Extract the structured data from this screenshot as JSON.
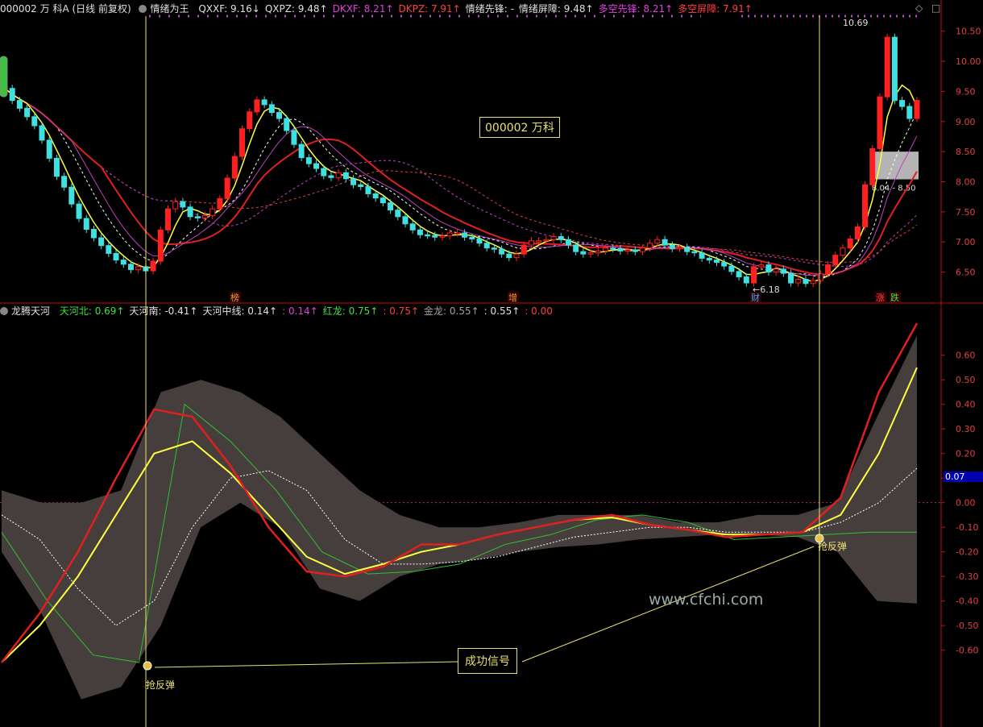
{
  "header": {
    "stock": "000002 万 科A (日线 前复权)",
    "indicator_name": "情绪为王",
    "items": [
      {
        "text": "QXXF: 9.16↓",
        "color": "#e0e0e0"
      },
      {
        "text": "QXPZ: 9.48↑",
        "color": "#e0e0e0"
      },
      {
        "text": "DKXF: 8.21↑",
        "color": "#e040e0"
      },
      {
        "text": "DKPZ: 7.91↑",
        "color": "#ff4040"
      },
      {
        "text": "情绪先锋: -",
        "color": "#e0e0e0"
      },
      {
        "text": "情绪屏障: 9.48↑",
        "color": "#e0e0e0"
      },
      {
        "text": "多空先锋: 8.21↑",
        "color": "#e040e0"
      },
      {
        "text": "多空屏障: 7.91↑",
        "color": "#ff4040"
      }
    ]
  },
  "sub_header": {
    "indicator_name": "龙腾天河",
    "items": [
      {
        "text": "天河北: 0.69↑",
        "color": "#40e040"
      },
      {
        "text": "天河南: -0.41↑",
        "color": "#e0e0e0"
      },
      {
        "text": "天河中线: 0.14↑",
        "color": "#e0e0e0"
      },
      {
        "text": ": 0.14↑",
        "color": "#e040e0"
      },
      {
        "text": "红龙: 0.75↑",
        "color": "#40e040"
      },
      {
        "text": ": 0.75↑",
        "color": "#ff4040"
      },
      {
        "text": "金龙: 0.55↑",
        "color": "#a0a0a0"
      },
      {
        "text": ": 0.55↑",
        "color": "#e0e0e0"
      },
      {
        "text": ": 0.00",
        "color": "#ff4040"
      }
    ]
  },
  "price_box": "000002 万科",
  "signal_box": "成功信号",
  "watermark": "www.cfchi.com",
  "colors": {
    "axis": "#c01010",
    "up": "#ff2020",
    "down": "#40e0e0",
    "ma5": "#ffffff",
    "ma10": "#ffff40",
    "ma20": "#c040c0",
    "ma30": "#e02020"
  },
  "chart_data": [
    {
      "type": "candlestick",
      "title": "000002 万 科A (日线 前复权)",
      "ylim": [
        6.2,
        10.75
      ],
      "yticks": [
        "10.50",
        "10.00",
        "9.50",
        "9.00",
        "8.50",
        "8.00",
        "7.50",
        "7.00",
        "6.50"
      ],
      "high_label": "10.69",
      "low_label": "6.18",
      "zone_label": "8.04 - 8.50",
      "zone": [
        8.04,
        8.5
      ],
      "event_markers": [
        "榜",
        "增",
        "财",
        "涨",
        "跌"
      ],
      "close": [
        9.55,
        9.35,
        9.22,
        9.08,
        8.93,
        8.69,
        8.39,
        8.09,
        7.91,
        7.63,
        7.39,
        7.21,
        7.07,
        6.94,
        6.81,
        6.7,
        6.63,
        6.54,
        6.59,
        6.52,
        6.68,
        7.2,
        7.55,
        7.67,
        7.58,
        7.42,
        7.4,
        7.44,
        7.55,
        7.72,
        8.06,
        8.42,
        8.88,
        9.16,
        9.36,
        9.28,
        9.15,
        9.05,
        8.85,
        8.62,
        8.4,
        8.3,
        8.22,
        8.1,
        8.07,
        8.15,
        8.05,
        7.95,
        7.92,
        7.8,
        7.73,
        7.65,
        7.53,
        7.42,
        7.3,
        7.2,
        7.12,
        7.11,
        7.08,
        7.1,
        7.15,
        7.15,
        7.08,
        7.05,
        6.98,
        6.9,
        6.88,
        6.8,
        6.74,
        6.8,
        6.95,
        7.02,
        7.02,
        7.04,
        7.09,
        7.04,
        6.95,
        6.84,
        6.8,
        6.82,
        6.85,
        6.9,
        6.89,
        6.85,
        6.87,
        6.84,
        6.9,
        6.98,
        7.04,
        6.95,
        6.89,
        6.91,
        6.84,
        6.82,
        6.73,
        6.7,
        6.66,
        6.6,
        6.51,
        6.42,
        6.32,
        6.59,
        6.62,
        6.5,
        6.55,
        6.48,
        6.32,
        6.38,
        6.31,
        6.36,
        6.47,
        6.62,
        6.78,
        6.9,
        7.05,
        7.25,
        7.95,
        8.55,
        9.41,
        10.4,
        9.35,
        9.25,
        9.05,
        9.35
      ],
      "ma5_last": 9.16,
      "ma10_last": 9.48,
      "ma20_last": 8.21,
      "ma30_last": 7.91
    },
    {
      "type": "line",
      "title": "龙腾天河",
      "ylim": [
        -0.88,
        0.75
      ],
      "yticks": [
        "0.60",
        "0.50",
        "0.40",
        "0.30",
        "0.20",
        "0.10",
        "0.00",
        "-0.10",
        "-0.20",
        "-0.30",
        "-0.40",
        "-0.50",
        "-0.60"
      ],
      "current_value": "0.07",
      "signal_label": "抢反弹",
      "series": [
        {
          "name": "红龙",
          "values": [
            -0.65,
            -0.45,
            -0.2,
            0.1,
            0.38,
            0.35,
            0.15,
            -0.1,
            -0.28,
            -0.3,
            -0.26,
            -0.17,
            -0.17,
            -0.13,
            -0.1,
            -0.07,
            -0.05,
            -0.09,
            -0.11,
            -0.14,
            -0.13,
            -0.12,
            0.02,
            0.45,
            0.73
          ]
        },
        {
          "name": "金龙",
          "values": [
            -0.65,
            -0.5,
            -0.3,
            -0.05,
            0.2,
            0.25,
            0.12,
            -0.05,
            -0.22,
            -0.29,
            -0.25,
            -0.2,
            -0.17,
            -0.13,
            -0.1,
            -0.07,
            -0.06,
            -0.09,
            -0.11,
            -0.13,
            -0.13,
            -0.12,
            -0.05,
            0.2,
            0.55
          ]
        },
        {
          "name": "天河中线",
          "values": [
            -0.05,
            -0.15,
            -0.35,
            -0.5,
            -0.4,
            -0.1,
            0.1,
            0.13,
            0.05,
            -0.15,
            -0.25,
            -0.25,
            -0.24,
            -0.22,
            -0.18,
            -0.14,
            -0.12,
            -0.1,
            -0.1,
            -0.12,
            -0.12,
            -0.12,
            -0.08,
            0.0,
            0.14
          ]
        },
        {
          "name": "天河北",
          "values": [
            -0.12,
            -0.4,
            -0.62,
            -0.65,
            0.4,
            0.25,
            0.05,
            -0.2,
            -0.29,
            -0.28,
            -0.25,
            -0.17,
            -0.13,
            -0.07,
            -0.05,
            -0.08,
            -0.15,
            -0.14,
            -0.13,
            -0.12,
            -0.12
          ]
        },
        {
          "name": "band_upper",
          "values": [
            0.05,
            0.0,
            0.0,
            0.05,
            0.45,
            0.5,
            0.45,
            0.35,
            0.2,
            0.05,
            -0.05,
            -0.1,
            -0.1,
            -0.08,
            -0.05,
            -0.05,
            -0.05,
            -0.08,
            -0.08,
            -0.05,
            -0.05,
            0.0,
            0.35,
            0.68
          ]
        },
        {
          "name": "band_lower",
          "values": [
            -0.2,
            -0.45,
            -0.8,
            -0.75,
            -0.5,
            -0.1,
            0.0,
            -0.1,
            -0.35,
            -0.4,
            -0.3,
            -0.25,
            -0.23,
            -0.2,
            -0.18,
            -0.17,
            -0.15,
            -0.14,
            -0.13,
            -0.13,
            -0.14,
            -0.2,
            -0.4,
            -0.41
          ]
        }
      ]
    }
  ]
}
